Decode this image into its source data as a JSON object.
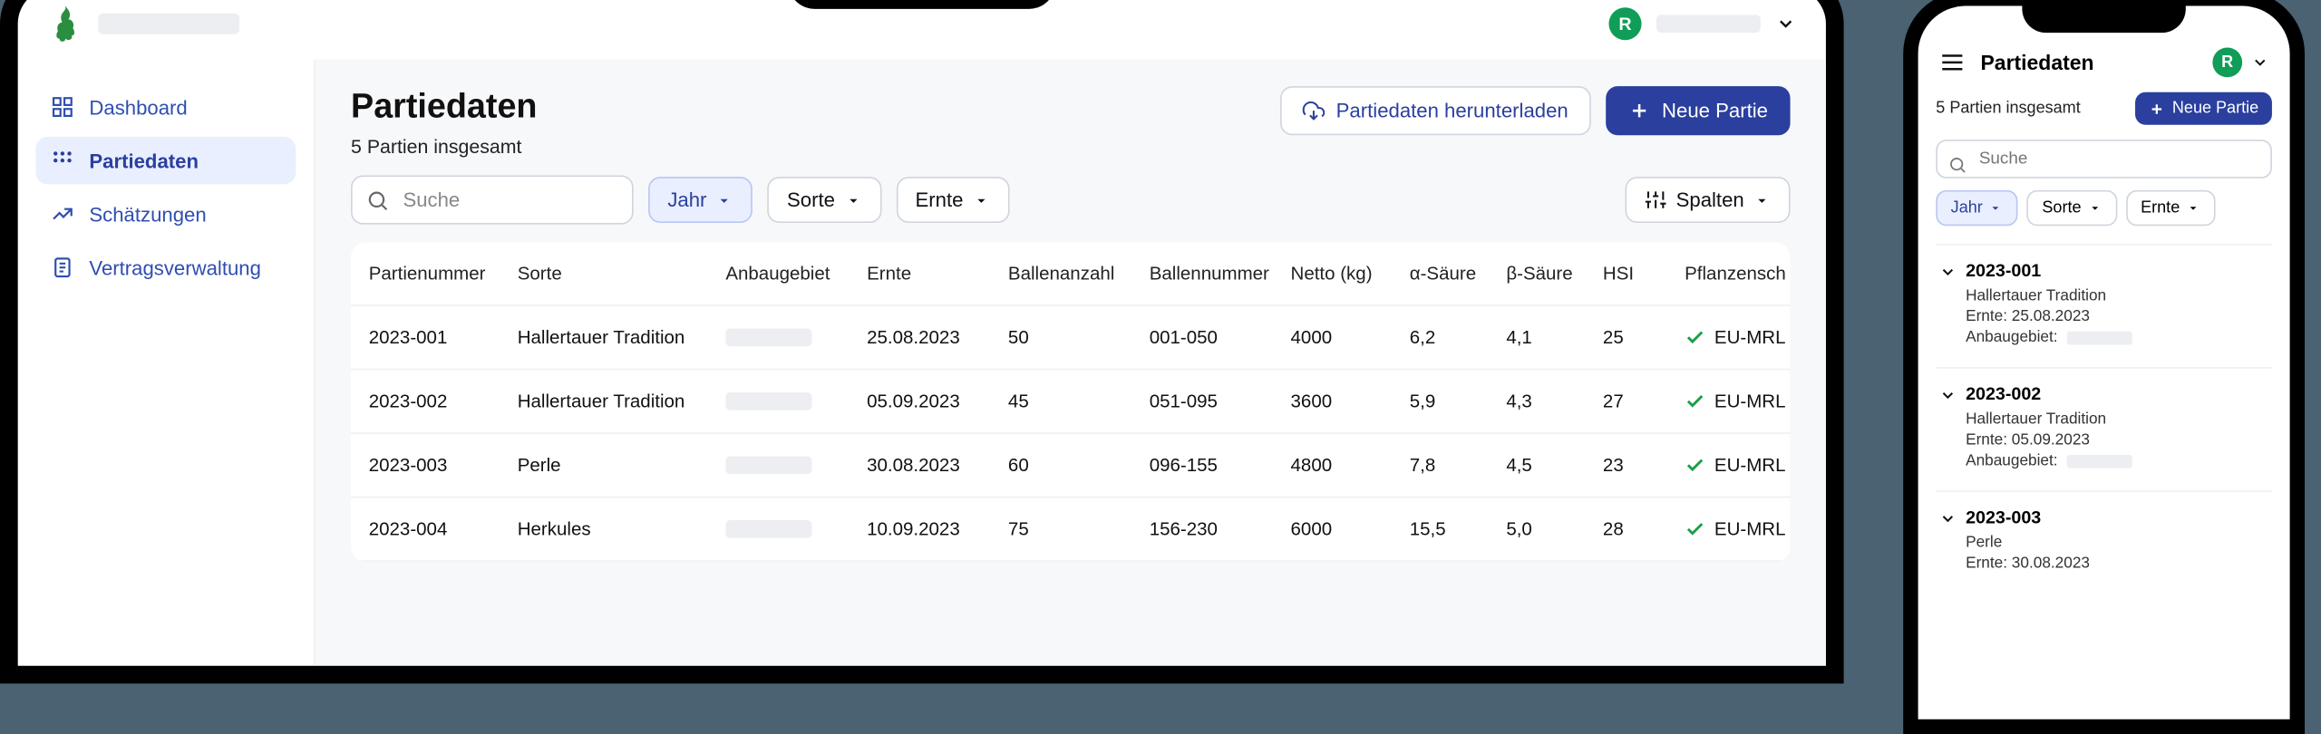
{
  "user": {
    "initial": "R"
  },
  "sidebar": {
    "items": [
      {
        "label": "Dashboard"
      },
      {
        "label": "Partiedaten"
      },
      {
        "label": "Schätzungen"
      },
      {
        "label": "Vertragsverwaltung"
      }
    ]
  },
  "page": {
    "title": "Partiedaten",
    "subtitle": "5 Partien insgesamt"
  },
  "actions": {
    "download": "Partiedaten herunterladen",
    "new": "Neue Partie"
  },
  "search": {
    "placeholder": "Suche"
  },
  "filters": {
    "year": "Jahr",
    "variety": "Sorte",
    "harvest": "Ernte",
    "columns": "Spalten"
  },
  "table": {
    "headers": {
      "pnum": "Partienummer",
      "variety": "Sorte",
      "area": "Anbaugebiet",
      "harvest": "Ernte",
      "bales": "Ballenanzahl",
      "balenum": "Ballennummer",
      "net": "Netto (kg)",
      "alpha": "α-Säure",
      "beta": "β-Säure",
      "hsi": "HSI",
      "plant": "Pflanzensch"
    },
    "rows": [
      {
        "pnum": "2023-001",
        "variety": "Hallertauer Tradition",
        "harvest": "25.08.2023",
        "bales": "50",
        "balenum": "001-050",
        "net": "4000",
        "alpha": "6,2",
        "beta": "4,1",
        "hsi": "25",
        "plant": "EU-MRL"
      },
      {
        "pnum": "2023-002",
        "variety": "Hallertauer Tradition",
        "harvest": "05.09.2023",
        "bales": "45",
        "balenum": "051-095",
        "net": "3600",
        "alpha": "5,9",
        "beta": "4,3",
        "hsi": "27",
        "plant": "EU-MRL"
      },
      {
        "pnum": "2023-003",
        "variety": "Perle",
        "harvest": "30.08.2023",
        "bales": "60",
        "balenum": "096-155",
        "net": "4800",
        "alpha": "7,8",
        "beta": "4,5",
        "hsi": "23",
        "plant": "EU-MRL"
      },
      {
        "pnum": "2023-004",
        "variety": "Herkules",
        "harvest": "10.09.2023",
        "bales": "75",
        "balenum": "156-230",
        "net": "6000",
        "alpha": "15,5",
        "beta": "5,0",
        "hsi": "28",
        "plant": "EU-MRL"
      }
    ]
  },
  "mobile": {
    "title": "Partiedaten",
    "subtitle": "5 Partien insgesamt",
    "harvest_prefix": "Ernte:",
    "area_prefix": "Anbaugebiet:",
    "cards": [
      {
        "pnum": "2023-001",
        "variety": "Hallertauer Tradition",
        "harvest": "Ernte: 25.08.2023"
      },
      {
        "pnum": "2023-002",
        "variety": "Hallertauer Tradition",
        "harvest": "Ernte: 05.09.2023"
      },
      {
        "pnum": "2023-003",
        "variety": "Perle",
        "harvest": "Ernte: 30.08.2023"
      }
    ]
  }
}
